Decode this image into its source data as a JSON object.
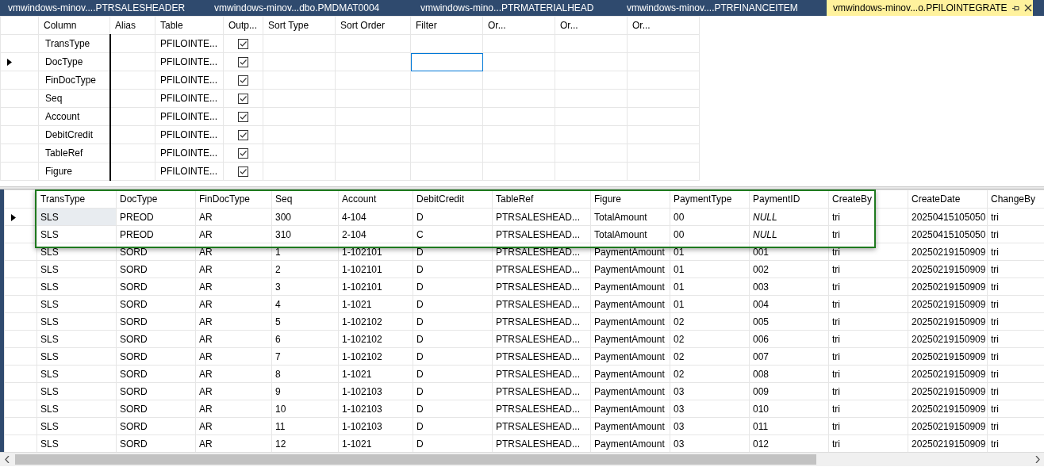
{
  "tabs": [
    {
      "label": "vmwindows-minov....PTRSALESHEADER",
      "selected": false
    },
    {
      "label": "vmwindows-minov...dbo.PMDMAT0004",
      "selected": false
    },
    {
      "label": "vmwindows-mino...PTRMATERIALHEAD",
      "selected": false
    },
    {
      "label": "vmwindows-minov....PTRFINANCEITEM",
      "selected": false
    },
    {
      "label": "vmwindows-minov...o.PFILOINTEGRATE",
      "selected": true
    }
  ],
  "criteria": {
    "columns": [
      "Column",
      "Alias",
      "Table",
      "Outp...",
      "Sort Type",
      "Sort Order",
      "Filter",
      "Or...",
      "Or...",
      "Or..."
    ],
    "rows": [
      {
        "column": "TransType",
        "table": "PFILOINTE...",
        "output": true,
        "selected": false
      },
      {
        "column": "DocType",
        "table": "PFILOINTE...",
        "output": true,
        "selected": true
      },
      {
        "column": "FinDocType",
        "table": "PFILOINTE...",
        "output": true,
        "selected": false
      },
      {
        "column": "Seq",
        "table": "PFILOINTE...",
        "output": true,
        "selected": false
      },
      {
        "column": "Account",
        "table": "PFILOINTE...",
        "output": true,
        "selected": false
      },
      {
        "column": "DebitCredit",
        "table": "PFILOINTE...",
        "output": true,
        "selected": false
      },
      {
        "column": "TableRef",
        "table": "PFILOINTE...",
        "output": true,
        "selected": false
      },
      {
        "column": "Figure",
        "table": "PFILOINTE...",
        "output": true,
        "selected": false
      }
    ]
  },
  "results": {
    "columns": [
      "TransType",
      "DocType",
      "FinDocType",
      "Seq",
      "Account",
      "DebitCredit",
      "TableRef",
      "Figure",
      "PaymentType",
      "PaymentID",
      "CreateBy",
      "CreateDate",
      "ChangeBy"
    ],
    "rows": [
      {
        "selected": true,
        "cells": [
          "SLS",
          "PREOD",
          "AR",
          "300",
          "4-104",
          "D",
          "PTRSALESHEAD...",
          "TotalAmount",
          "00",
          {
            "text": "NULL",
            "kind": "null"
          },
          "tri",
          "20250415105050",
          "tri"
        ]
      },
      {
        "selected": false,
        "cells": [
          "SLS",
          "PREOD",
          "AR",
          "310",
          "2-104",
          "C",
          "PTRSALESHEAD...",
          "TotalAmount",
          "00",
          {
            "text": "NULL",
            "kind": "null"
          },
          "tri",
          "20250415105050",
          "tri"
        ]
      },
      {
        "selected": false,
        "cells": [
          "SLS",
          "SORD",
          "AR",
          "1",
          "1-102101",
          "D",
          "PTRSALESHEAD...",
          "PaymentAmount",
          "01",
          "001",
          "tri",
          "20250219150909",
          "tri"
        ]
      },
      {
        "selected": false,
        "cells": [
          "SLS",
          "SORD",
          "AR",
          "2",
          "1-102101",
          "D",
          "PTRSALESHEAD...",
          "PaymentAmount",
          "01",
          "002",
          "tri",
          "20250219150909",
          "tri"
        ]
      },
      {
        "selected": false,
        "cells": [
          "SLS",
          "SORD",
          "AR",
          "3",
          "1-102101",
          "D",
          "PTRSALESHEAD...",
          "PaymentAmount",
          "01",
          "003",
          "tri",
          "20250219150909",
          "tri"
        ]
      },
      {
        "selected": false,
        "cells": [
          "SLS",
          "SORD",
          "AR",
          "4",
          "1-1021",
          "D",
          "PTRSALESHEAD...",
          "PaymentAmount",
          "01",
          "004",
          "tri",
          "20250219150909",
          "tri"
        ]
      },
      {
        "selected": false,
        "cells": [
          "SLS",
          "SORD",
          "AR",
          "5",
          "1-102102",
          "D",
          "PTRSALESHEAD...",
          "PaymentAmount",
          "02",
          "005",
          "tri",
          "20250219150909",
          "tri"
        ]
      },
      {
        "selected": false,
        "cells": [
          "SLS",
          "SORD",
          "AR",
          "6",
          "1-102102",
          "D",
          "PTRSALESHEAD...",
          "PaymentAmount",
          "02",
          "006",
          "tri",
          "20250219150909",
          "tri"
        ]
      },
      {
        "selected": false,
        "cells": [
          "SLS",
          "SORD",
          "AR",
          "7",
          "1-102102",
          "D",
          "PTRSALESHEAD...",
          "PaymentAmount",
          "02",
          "007",
          "tri",
          "20250219150909",
          "tri"
        ]
      },
      {
        "selected": false,
        "cells": [
          "SLS",
          "SORD",
          "AR",
          "8",
          "1-1021",
          "D",
          "PTRSALESHEAD...",
          "PaymentAmount",
          "02",
          "008",
          "tri",
          "20250219150909",
          "tri"
        ]
      },
      {
        "selected": false,
        "cells": [
          "SLS",
          "SORD",
          "AR",
          "9",
          "1-102103",
          "D",
          "PTRSALESHEAD...",
          "PaymentAmount",
          "03",
          "009",
          "tri",
          "20250219150909",
          "tri"
        ]
      },
      {
        "selected": false,
        "cells": [
          "SLS",
          "SORD",
          "AR",
          "10",
          "1-102103",
          "D",
          "PTRSALESHEAD...",
          "PaymentAmount",
          "03",
          "010",
          "tri",
          "20250219150909",
          "tri"
        ]
      },
      {
        "selected": false,
        "cells": [
          "SLS",
          "SORD",
          "AR",
          "11",
          "1-102103",
          "D",
          "PTRSALESHEAD...",
          "PaymentAmount",
          "03",
          "011",
          "tri",
          "20250219150909",
          "tri"
        ]
      },
      {
        "selected": false,
        "cells": [
          "SLS",
          "SORD",
          "AR",
          "12",
          "1-1021",
          "D",
          "PTRSALESHEAD...",
          "PaymentAmount",
          "03",
          "012",
          "tri",
          "20250219150909",
          "tri"
        ]
      }
    ]
  }
}
